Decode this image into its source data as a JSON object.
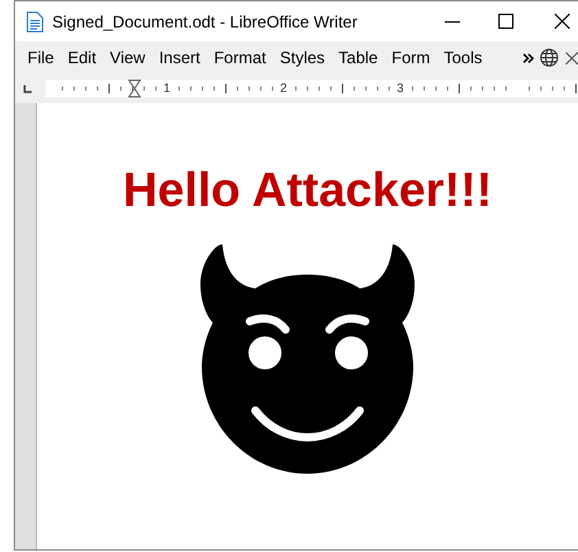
{
  "window": {
    "title": "Signed_Document.odt - LibreOffice Writer"
  },
  "menu": [
    "File",
    "Edit",
    "View",
    "Insert",
    "Format",
    "Styles",
    "Table",
    "Form",
    "Tools"
  ],
  "ruler": {
    "labels": [
      "1",
      "2",
      "3"
    ]
  },
  "document": {
    "heading": "Hello Attacker!!!"
  }
}
